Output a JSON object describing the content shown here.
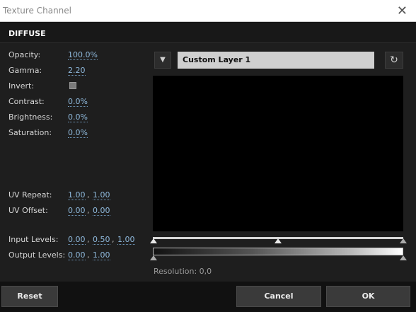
{
  "window": {
    "title": "Texture Channel",
    "close_glyph": "✕"
  },
  "section": {
    "title": "DIFFUSE"
  },
  "props": {
    "opacity": {
      "label": "Opacity:",
      "value": "100.0%"
    },
    "gamma": {
      "label": "Gamma:",
      "value": "2.20"
    },
    "invert": {
      "label": "Invert:",
      "checked": false
    },
    "contrast": {
      "label": "Contrast:",
      "value": "0.0%"
    },
    "brightness": {
      "label": "Brightness:",
      "value": "0.0%"
    },
    "saturation": {
      "label": "Saturation:",
      "value": "0.0%"
    },
    "uv_repeat": {
      "label": "UV Repeat:",
      "u": "1.00",
      "v": "1.00"
    },
    "uv_offset": {
      "label": "UV Offset:",
      "u": "0.00",
      "v": "0.00"
    },
    "input_levels": {
      "label": "Input Levels:",
      "low": "0.00",
      "mid": "0.50",
      "high": "1.00"
    },
    "output_levels": {
      "label": "Output Levels:",
      "low": "0.00",
      "high": "1.00"
    }
  },
  "separator": ",",
  "layer": {
    "dropdown_glyph": "▼",
    "name": "Custom Layer 1",
    "refresh_glyph": "↻"
  },
  "resolution": "Resolution: 0,0",
  "footer": {
    "reset": "Reset",
    "cancel": "Cancel",
    "ok": "OK"
  },
  "colors": {
    "value_link": "#8fb9dc",
    "panel": "#1e1e1e",
    "footer": "#111111"
  }
}
